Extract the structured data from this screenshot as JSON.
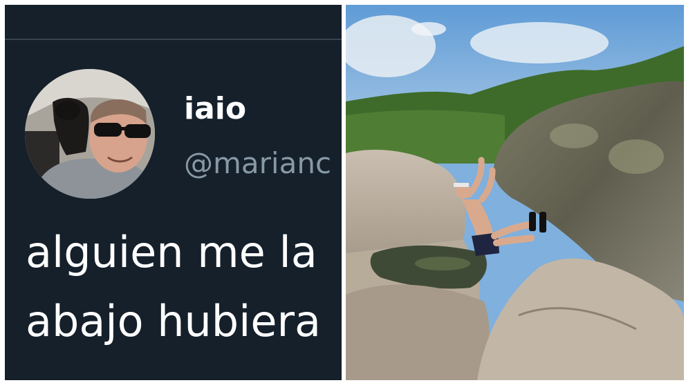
{
  "tweet": {
    "display_name": "iaio",
    "handle": "@marianc",
    "text_lines": [
      "alguien me la",
      "abajo hubiera"
    ]
  },
  "colors": {
    "background": "#15202b",
    "divider": "#38444d",
    "primary_text": "#ffffff",
    "secondary_text": "#8899a6"
  },
  "icons": {
    "avatar": "profile-photo",
    "photo": "climber-on-boulder-photo"
  }
}
